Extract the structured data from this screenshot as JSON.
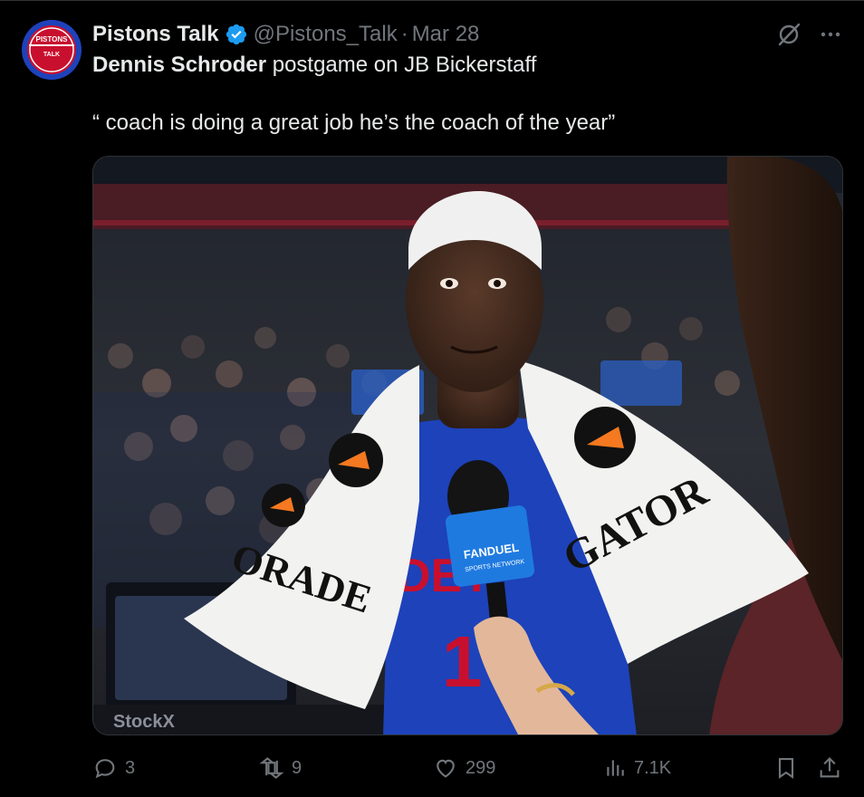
{
  "account": {
    "display_name": "Pistons Talk",
    "handle": "@Pistons_Talk",
    "separator": "·",
    "date": "Mar 28",
    "avatar_text_line1": "PISTONS",
    "avatar_text_line2": "TALK"
  },
  "tweet": {
    "bold_name": "Dennis Schroder",
    "text_line1_rest": " postgame on JB Bickerstaff",
    "quote": "“ coach is doing a great job he’s the coach of the year”"
  },
  "media": {
    "alt": "Dennis Schroder interviewed courtside wearing a Gatorade towel and headband, holding a FanDuel Sports Network microphone",
    "towel_text_left": "ORADE",
    "towel_text_right": "GATOR",
    "mic_text_line1": "FANDUEL",
    "mic_text_line2": "SPORTS NETWORK",
    "jersey_text": "DET",
    "jersey_number": "1",
    "board_text": "StockX"
  },
  "actions": {
    "replies": "3",
    "reposts": "9",
    "likes": "299",
    "views": "7.1K"
  },
  "colors": {
    "background": "#000000",
    "text_primary": "#e7e9ea",
    "text_secondary": "#71767b",
    "verified_blue": "#1d9bf0",
    "pistons_blue": "#1d42ba",
    "pistons_red": "#c8102e"
  },
  "icons": {
    "verified": "verified-badge-icon",
    "grok": "grok-icon",
    "more": "more-icon",
    "reply": "reply-icon",
    "repost": "repost-icon",
    "like": "like-icon",
    "views": "views-icon",
    "bookmark": "bookmark-icon",
    "share": "share-icon"
  }
}
